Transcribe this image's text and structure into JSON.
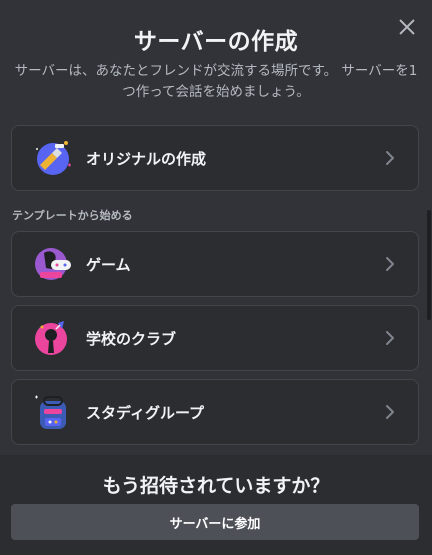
{
  "modal": {
    "title": "サーバーの作成",
    "description": "サーバーは、あなたとフレンドが交流する場所です。 サーバーを1つ作って会話を始めましょう。",
    "close_icon": "close-icon"
  },
  "create_own": {
    "label": "オリジナルの作成",
    "icon": "create-own-server-icon"
  },
  "templates": {
    "section_label": "テンプレートから始める",
    "items": [
      {
        "label": "ゲーム",
        "icon": "gaming-icon"
      },
      {
        "label": "学校のクラブ",
        "icon": "school-club-icon"
      },
      {
        "label": "スタディグループ",
        "icon": "study-group-icon"
      }
    ]
  },
  "footer": {
    "title": "もう招待されていますか？",
    "join_button": "サーバーに参加"
  },
  "colors": {
    "background": "#313338",
    "card": "#2b2d31",
    "border": "#43454b",
    "button": "#4e5058",
    "text": "#f2f3f5",
    "muted": "#b5bac1"
  }
}
